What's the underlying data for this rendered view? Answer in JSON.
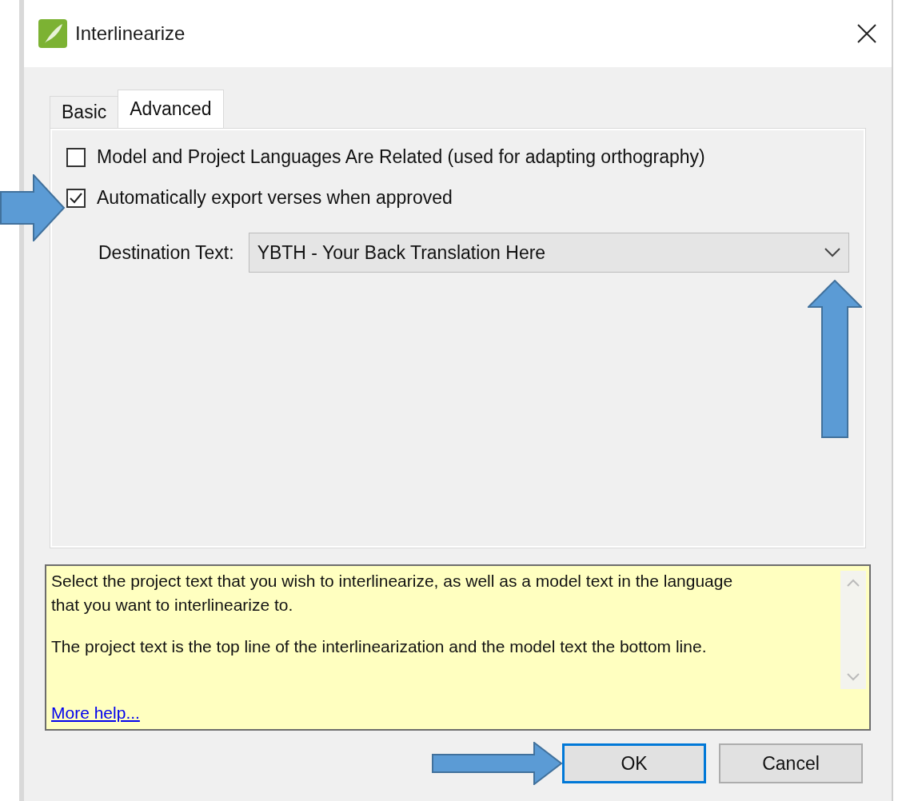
{
  "window": {
    "title": "Interlinearize"
  },
  "tabs": [
    {
      "label": "Basic",
      "selected": false
    },
    {
      "label": "Advanced",
      "selected": true
    }
  ],
  "options": [
    {
      "kind": "checkbox",
      "label": "Model and Project Languages Are Related (used for adapting orthography)",
      "checked": false
    },
    {
      "kind": "checkbox",
      "label": "Automatically export verses when approved",
      "checked": true
    }
  ],
  "destination": {
    "label": "Destination Text:",
    "value": "YBTH - Your Back Translation Here"
  },
  "help": {
    "paragraphs": [
      "Select the project text that you wish to interlinearize, as well as a model text in the language that you want to interlinearize to.",
      "The project text is the top line of the interlinearization and the model text the bottom line."
    ],
    "link": "More help..."
  },
  "buttons": [
    {
      "label": "OK",
      "default": true
    },
    {
      "label": "Cancel",
      "default": false
    }
  ]
}
